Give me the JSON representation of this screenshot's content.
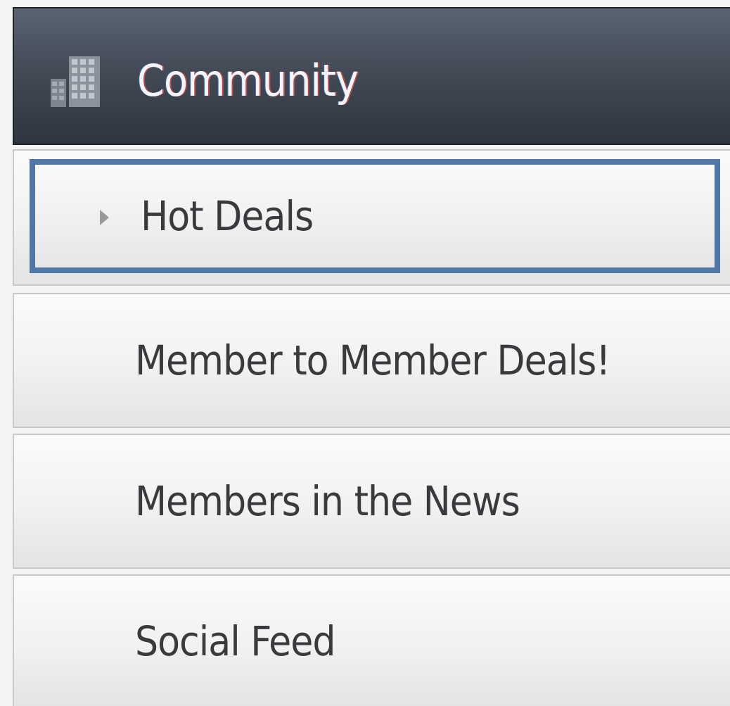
{
  "header": {
    "title": "Community",
    "icon": "building-icon"
  },
  "menu": {
    "items": [
      {
        "label": "Hot Deals",
        "state": "focused",
        "icon": "caret-right-icon"
      },
      {
        "label": "Member to Member Deals!"
      },
      {
        "label": "Members in the News"
      },
      {
        "label": "Social Feed"
      }
    ]
  },
  "colors": {
    "header_top": "#5a6371",
    "header_bottom": "#2e3540",
    "focus_border": "#4f78a8",
    "item_text": "#3a3a3e"
  }
}
